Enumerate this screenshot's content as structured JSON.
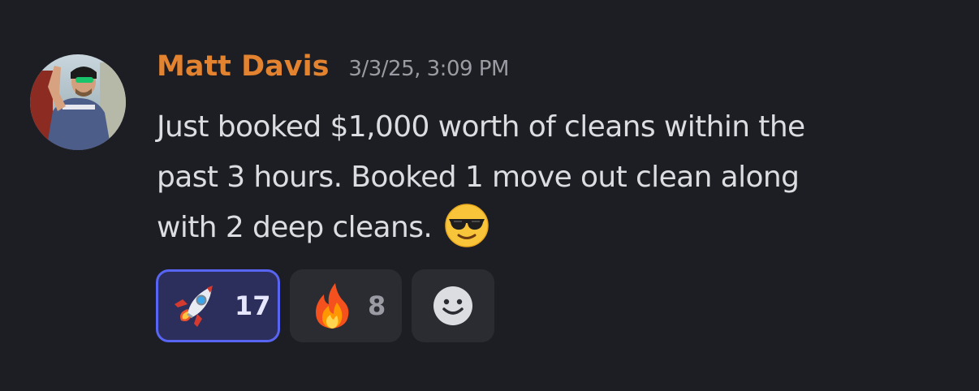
{
  "message": {
    "author": "Matt Davis",
    "timestamp": "3/3/25, 3:09 PM",
    "author_color": "#e3822f",
    "avatar": "user-avatar-photo",
    "body_lines": [
      "Just booked $1,000 worth of cleans within the",
      "past 3 hours. Booked 1 move out clean along",
      "with 2 deep cleans."
    ],
    "inline_emoji": "smiling-face-with-sunglasses"
  },
  "reactions": [
    {
      "emoji": "rocket",
      "count": "17",
      "active": true
    },
    {
      "emoji": "fire",
      "count": "8",
      "active": false
    },
    {
      "emoji": "add-reaction-smiley",
      "count": "",
      "active": false
    }
  ],
  "colors": {
    "background": "#1d1e23",
    "active_reaction_border": "#5865f2",
    "active_reaction_bg": "#2c2e5b",
    "reaction_bg": "#2b2c32"
  }
}
